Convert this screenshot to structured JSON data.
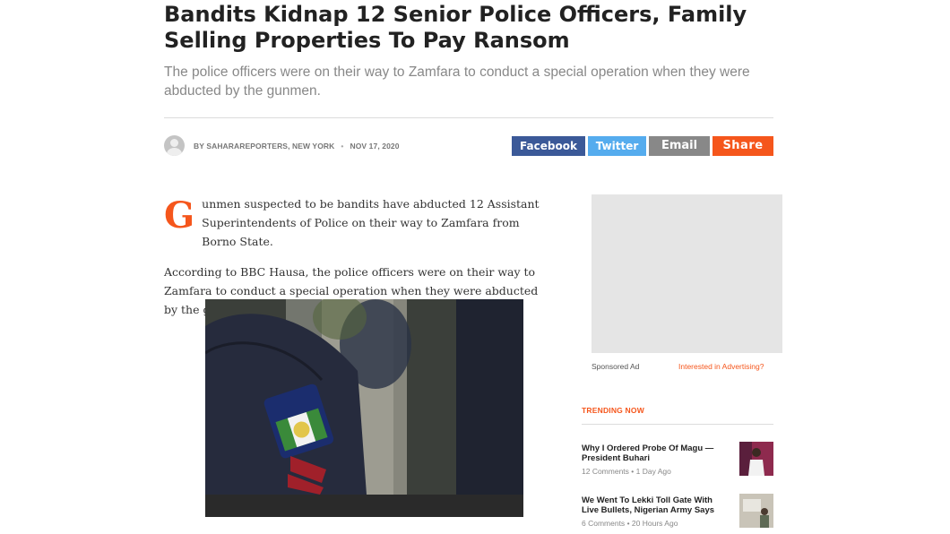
{
  "article": {
    "headline": "Bandits Kidnap 12 Senior Police Officers, Family Selling Properties To Pay Ransom",
    "subheadline": "The police officers were on their way to Zamfara to conduct a special operation when they were abducted by the gunmen.",
    "author": "BY SAHARAREPORTERS, NEW YORK",
    "separator": "•",
    "date": "NOV 17, 2020",
    "dropcap": "G",
    "para1": "unmen suspected to be bandits have abducted 12 Assistant Superintendents of Police on their way to Zamfara from Borno State.",
    "para2": "According to BBC Hausa, the police officers were on their way to Zamfara to conduct a special operation when they were abducted by the gunmen."
  },
  "share": {
    "facebook": "Facebook",
    "twitter": "Twitter",
    "email": "Email",
    "share": "Share"
  },
  "colors": {
    "accent": "#f5561c",
    "facebook": "#3b5998",
    "twitter": "#55acee",
    "email": "#888888"
  },
  "icons": {
    "avatar": "user-avatar-icon"
  },
  "sidebar": {
    "sponsored": "Sponsored Ad",
    "advertising_link": "Interested in Advertising?",
    "trending_title": "TRENDING NOW",
    "items": [
      {
        "title": "Why I Ordered Probe Of Magu — President Buhari",
        "comments": "12 Comments",
        "dot": "•",
        "time": "1 Day Ago"
      },
      {
        "title": "We Went To Lekki Toll Gate With Live Bullets, Nigerian Army Says",
        "comments": "6 Comments",
        "dot": "•",
        "time": "20 Hours Ago"
      }
    ]
  }
}
